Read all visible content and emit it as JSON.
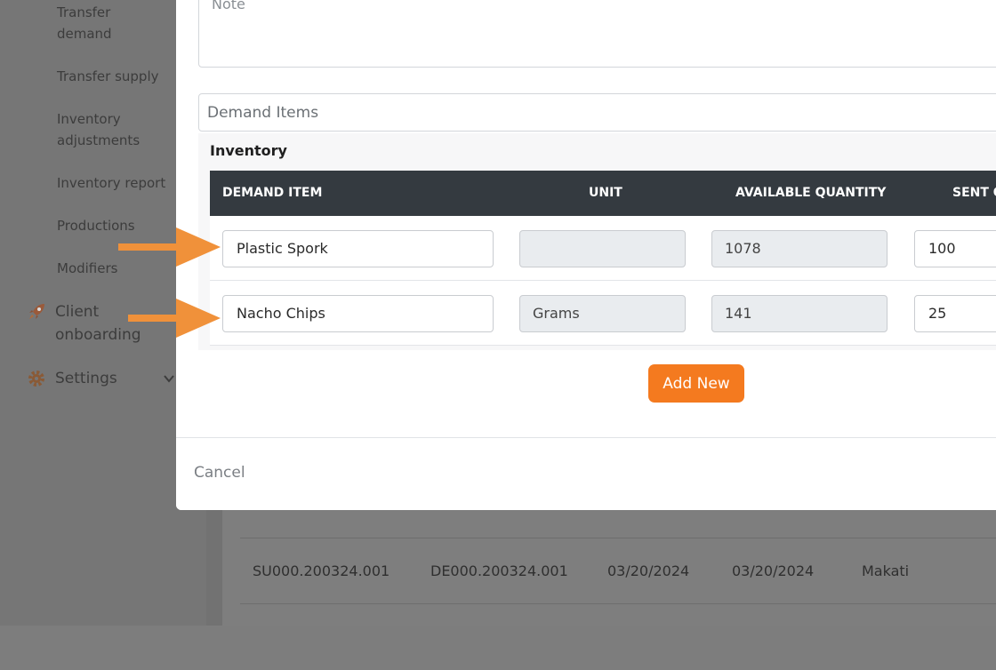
{
  "sidebar": {
    "items": [
      {
        "label": "Transfer\ndemand"
      },
      {
        "label": "Transfer supply"
      },
      {
        "label": "Inventory\nadjustments"
      },
      {
        "label": "Inventory report"
      },
      {
        "label": "Productions"
      },
      {
        "label": "Modifiers"
      }
    ],
    "client_onboarding": "Client\nonboarding",
    "settings": "Settings"
  },
  "background_table": {
    "rows": [
      {
        "supply": "SU000.200324.001",
        "demand": "DE000.200324.001",
        "date1": "03/20/2024",
        "date2": "03/20/2024",
        "location": "Makati"
      }
    ]
  },
  "modal": {
    "note_label": "Note",
    "demand_items_label": "Demand Items",
    "inventory_title": "Inventory",
    "columns": [
      "DEMAND ITEM",
      "UNIT",
      "AVAILABLE QUANTITY",
      "SENT Q"
    ],
    "rows": [
      {
        "item": "Plastic Spork",
        "unit": "",
        "available": "1078",
        "sent": "100"
      },
      {
        "item": "Nacho Chips",
        "unit": "Grams",
        "available": "141",
        "sent": "25"
      }
    ],
    "add_new": "Add New",
    "cancel": "Cancel"
  },
  "colors": {
    "accent": "#f47a1f",
    "arrow": "#f0913a",
    "table_header": "#343a40",
    "overlay": "#7d7d7d"
  }
}
